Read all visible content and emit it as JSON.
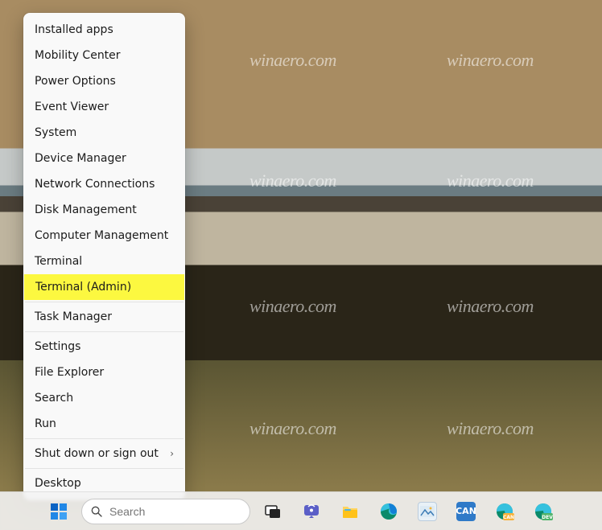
{
  "watermark": "winaero.com",
  "context_menu": {
    "items": [
      {
        "label": "Installed apps",
        "has_submenu": false,
        "highlight": false
      },
      {
        "label": "Mobility Center",
        "has_submenu": false,
        "highlight": false
      },
      {
        "label": "Power Options",
        "has_submenu": false,
        "highlight": false
      },
      {
        "label": "Event Viewer",
        "has_submenu": false,
        "highlight": false
      },
      {
        "label": "System",
        "has_submenu": false,
        "highlight": false
      },
      {
        "label": "Device Manager",
        "has_submenu": false,
        "highlight": false
      },
      {
        "label": "Network Connections",
        "has_submenu": false,
        "highlight": false
      },
      {
        "label": "Disk Management",
        "has_submenu": false,
        "highlight": false
      },
      {
        "label": "Computer Management",
        "has_submenu": false,
        "highlight": false
      },
      {
        "label": "Terminal",
        "has_submenu": false,
        "highlight": false
      },
      {
        "label": "Terminal (Admin)",
        "has_submenu": false,
        "highlight": true
      },
      {
        "separator": true
      },
      {
        "label": "Task Manager",
        "has_submenu": false,
        "highlight": false
      },
      {
        "separator": true
      },
      {
        "label": "Settings",
        "has_submenu": false,
        "highlight": false
      },
      {
        "label": "File Explorer",
        "has_submenu": false,
        "highlight": false
      },
      {
        "label": "Search",
        "has_submenu": false,
        "highlight": false
      },
      {
        "label": "Run",
        "has_submenu": false,
        "highlight": false
      },
      {
        "separator": true
      },
      {
        "label": "Shut down or sign out",
        "has_submenu": true,
        "highlight": false
      },
      {
        "separator": true
      },
      {
        "label": "Desktop",
        "has_submenu": false,
        "highlight": false
      }
    ]
  },
  "taskbar": {
    "search_placeholder": "Search",
    "icons": {
      "start": "start-icon",
      "search": "search-icon",
      "taskview": "task-view-icon",
      "chat": "chat-icon",
      "explorer": "file-explorer-icon",
      "edge": "edge-icon",
      "photos": "photos-icon",
      "canary1": "canary-icon",
      "canary2": "canary-icon",
      "dev": "dev-icon"
    }
  }
}
